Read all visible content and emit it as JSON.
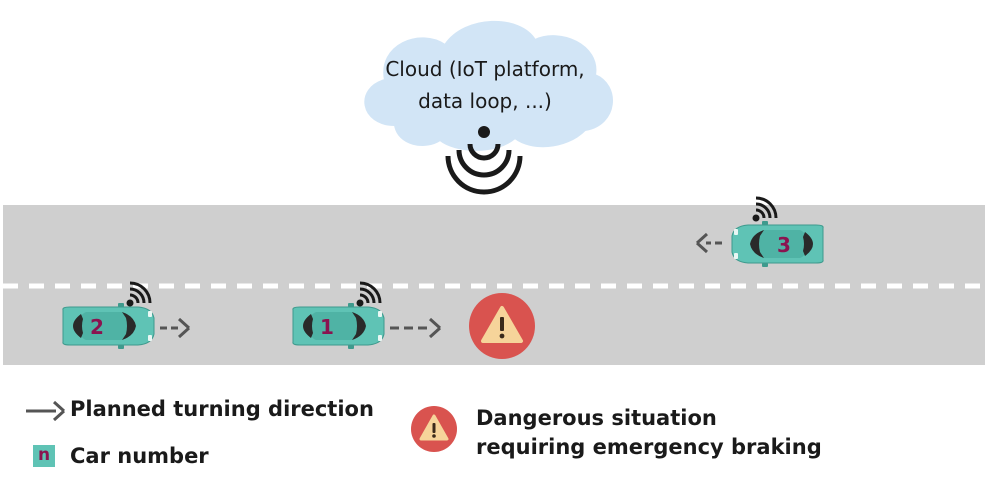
{
  "cloud": {
    "line1": "Cloud (IoT platform,",
    "line2": "data loop, ...)",
    "fill_color": "#d2e5f6",
    "icon": "wireless-broadcast-icon"
  },
  "road": {
    "surface_color": "#cfcfcf",
    "lane_marking": "dashed-white"
  },
  "cars": [
    {
      "number": "1",
      "direction": "right",
      "connected": true
    },
    {
      "number": "2",
      "direction": "right",
      "connected": true
    },
    {
      "number": "3",
      "direction": "left",
      "connected": true
    }
  ],
  "car_color": "#5fc3b5",
  "car_number_color": "#8a1450",
  "hazard": {
    "icon": "warning-icon",
    "circle_color": "#d9534f",
    "triangle_color": "#f6d49a"
  },
  "legend": {
    "arrow_label": "Planned turning direction",
    "swatch_symbol": "n",
    "car_label": "Car number",
    "danger_line1": "Dangerous situation",
    "danger_line2": "requiring emergency braking"
  }
}
